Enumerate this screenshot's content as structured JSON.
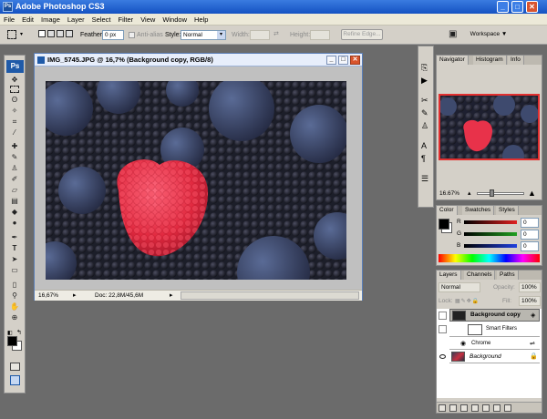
{
  "app": {
    "title": "Adobe Photoshop CS3",
    "logo": "Ps",
    "small_logo": "Ps"
  },
  "window_controls": {
    "min": "_",
    "max": "□",
    "close": "✕"
  },
  "menu": [
    "File",
    "Edit",
    "Image",
    "Layer",
    "Select",
    "Filter",
    "View",
    "Window",
    "Help"
  ],
  "options": {
    "feather_label": "Feather:",
    "feather_value": "0 px",
    "antialias_label": "Anti-alias",
    "style_label": "Style:",
    "style_value": "Normal",
    "width_label": "Width:",
    "height_label": "Height:",
    "refine_label": "Refine Edge...",
    "workspace_label": "Workspace ▼"
  },
  "document": {
    "title": "IMG_5745.JPG @ 16,7% (Background copy, RGB/8)",
    "zoom": "16,67%",
    "doc_size": "Doc: 22,8M/45,6M"
  },
  "navigator": {
    "tabs": [
      "Navigator",
      "Histogram",
      "Info"
    ],
    "zoom": "16.67%"
  },
  "color": {
    "tabs": [
      "Color",
      "Swatches",
      "Styles"
    ],
    "channels": [
      {
        "name": "R",
        "value": "0",
        "color": "#e02020"
      },
      {
        "name": "G",
        "value": "0",
        "color": "#20a020"
      },
      {
        "name": "B",
        "value": "0",
        "color": "#2040e0"
      }
    ]
  },
  "layers": {
    "tabs": [
      "Layers",
      "Channels",
      "Paths"
    ],
    "blend": "Normal",
    "opacity_label": "Opacity:",
    "opacity_value": "100%",
    "lock_label": "Lock:",
    "fill_label": "Fill:",
    "fill_value": "100%",
    "items": [
      {
        "name": "Background copy",
        "selected": true
      },
      {
        "name": "Smart Filters"
      },
      {
        "name": "Chrome"
      },
      {
        "name": "Background"
      }
    ]
  },
  "colors": {
    "accent": "#1452c2",
    "chrome": "#d4d0c8",
    "workspace": "#6b6b6b"
  }
}
